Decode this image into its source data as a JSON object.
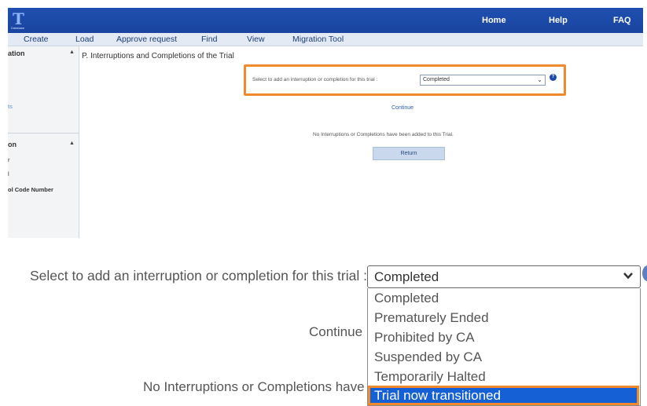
{
  "top": {
    "logo": {
      "glyph": "T",
      "sub_text": "Database"
    },
    "topnav": [
      "Home",
      "Help",
      "FAQ"
    ],
    "menu": [
      "Create",
      "Load",
      "Approve request",
      "Find",
      "View",
      "Migration Tool"
    ],
    "sidebar": {
      "section1_title": "ation",
      "section1_item": "ts",
      "section2_title": "on",
      "section2_items": [
        "r",
        "l",
        "ol Code Number"
      ]
    },
    "main_title": "P. Interruptions and Completions of the Trial",
    "select_label": "Select to add an interruption or completion for this trial :",
    "select_value": "Completed",
    "continue": "Continue",
    "no_interruptions": "No Interruptions or Completions have been added to this Trial.",
    "return_button": "Return"
  },
  "zoom": {
    "select_label": "Select to add an interruption or completion for this trial :",
    "select_value": "Completed",
    "options": [
      "Completed",
      "Prematurely Ended",
      "Prohibited by CA",
      "Suspended by CA",
      "Temporarily Halted",
      "Trial now transitioned"
    ],
    "highlighted_option": "Trial now transitioned",
    "continue": "Continue",
    "no_interruptions": "No Interruptions or Completions have been added to this Trial."
  },
  "colors": {
    "nav_blue": "#1e4fb0",
    "highlight_orange": "#f08a2c",
    "selected_option": "#1560d4"
  },
  "icons": [
    "chevron-down-icon",
    "help-icon",
    "scroll-up-icon"
  ]
}
